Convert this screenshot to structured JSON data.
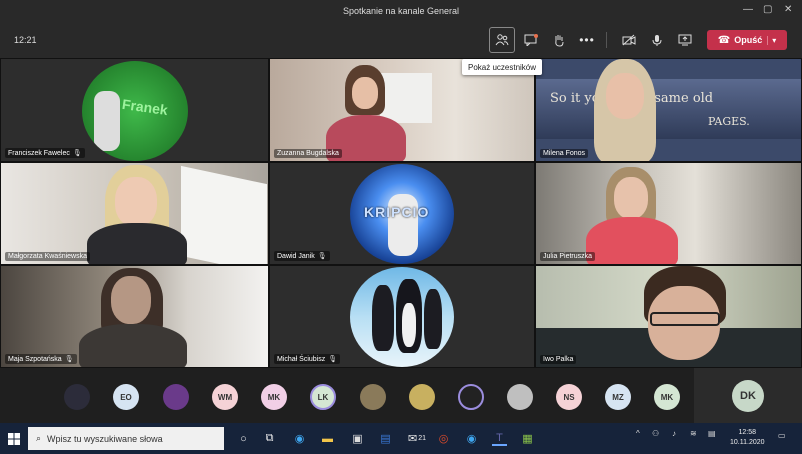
{
  "window": {
    "title": "Spotkanie na kanale General",
    "controls": [
      "—",
      "▢",
      "✕"
    ]
  },
  "toolbar": {
    "timer": "12:21",
    "leave_label": "Opuść",
    "leave_chevron": "▾",
    "tooltip": "Pokaż uczestników",
    "icons": {
      "participants": "participants-icon",
      "chat": "chat-icon",
      "raise_hand": "raise-hand-icon",
      "more": "more-icon",
      "camera": "camera-off-icon",
      "mic": "microphone-icon",
      "share": "share-screen-icon"
    },
    "colors": {
      "leave": "#c4314b"
    }
  },
  "tiles": [
    {
      "name": "Franciszek Fawelec",
      "avatar_text": "Franek"
    },
    {
      "name": "Zuzanna Bugdalska"
    },
    {
      "name": "Milena Fonos",
      "background_text": "So it you   of the same old",
      "background_text2": "PAGES."
    },
    {
      "name": "Małgorzata Kwaśniewska"
    },
    {
      "name": "Dawid Janik",
      "avatar_text": "KRIPCIO"
    },
    {
      "name": "Julia Pietruszka"
    },
    {
      "name": "Maja Szpotańska"
    },
    {
      "name": "Michał Ściubisz"
    },
    {
      "name": "Iwo Palka"
    }
  ],
  "strip": {
    "participants": [
      {
        "initials": "",
        "bg": "#2c2c3a"
      },
      {
        "initials": "EO",
        "bg": "#d6e4f2"
      },
      {
        "initials": "",
        "bg": "#6a3a8a"
      },
      {
        "initials": "WM",
        "bg": "#f5d2d6"
      },
      {
        "initials": "MK",
        "bg": "#f1cfe6"
      },
      {
        "initials": "LK",
        "bg": "#d4e6d3"
      },
      {
        "initials": "",
        "bg": "#8a7a5a"
      },
      {
        "initials": "",
        "bg": "#c8b060"
      },
      {
        "initials": "",
        "bg": "#222222"
      },
      {
        "initials": "",
        "bg": "#bfbfbf"
      },
      {
        "initials": "NS",
        "bg": "#f5d2d6"
      },
      {
        "initials": "MZ",
        "bg": "#d6e4f2"
      },
      {
        "initials": "MK",
        "bg": "#d4e6d3"
      }
    ],
    "self_initials": "DK"
  },
  "taskbar": {
    "search_placeholder": "Wpisz tu wyszukiwane słowa",
    "mail_badge": "21",
    "clock_time": "12:58",
    "clock_date": "10.11.2020"
  }
}
